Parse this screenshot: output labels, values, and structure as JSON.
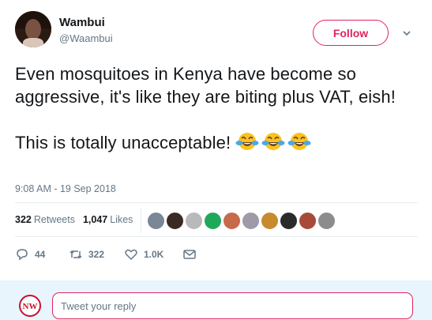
{
  "user": {
    "name": "Wambui",
    "handle": "@Waambui"
  },
  "follow_label": "Follow",
  "tweet": {
    "text": "Even mosquitoes in Kenya have become so aggressive, it's like they are biting plus VAT, eish!\n\nThis is totally unacceptable!",
    "emojis": [
      "face-with-tears-of-joy",
      "face-with-tears-of-joy",
      "face-with-tears-of-joy"
    ],
    "timestamp": "9:08 AM - 19 Sep 2018"
  },
  "stats": {
    "retweets_count": "322",
    "retweets_label": "Retweets",
    "likes_count": "1,047",
    "likes_label": "Likes"
  },
  "actions": {
    "replies": "44",
    "retweets": "322",
    "likes": "1.0K"
  },
  "reply": {
    "placeholder": "Tweet your reply",
    "avatar_text": "NW"
  },
  "colors": {
    "accent": "#e0245e",
    "secondary_text": "#657786",
    "reply_bar": "#e8f5fd"
  }
}
